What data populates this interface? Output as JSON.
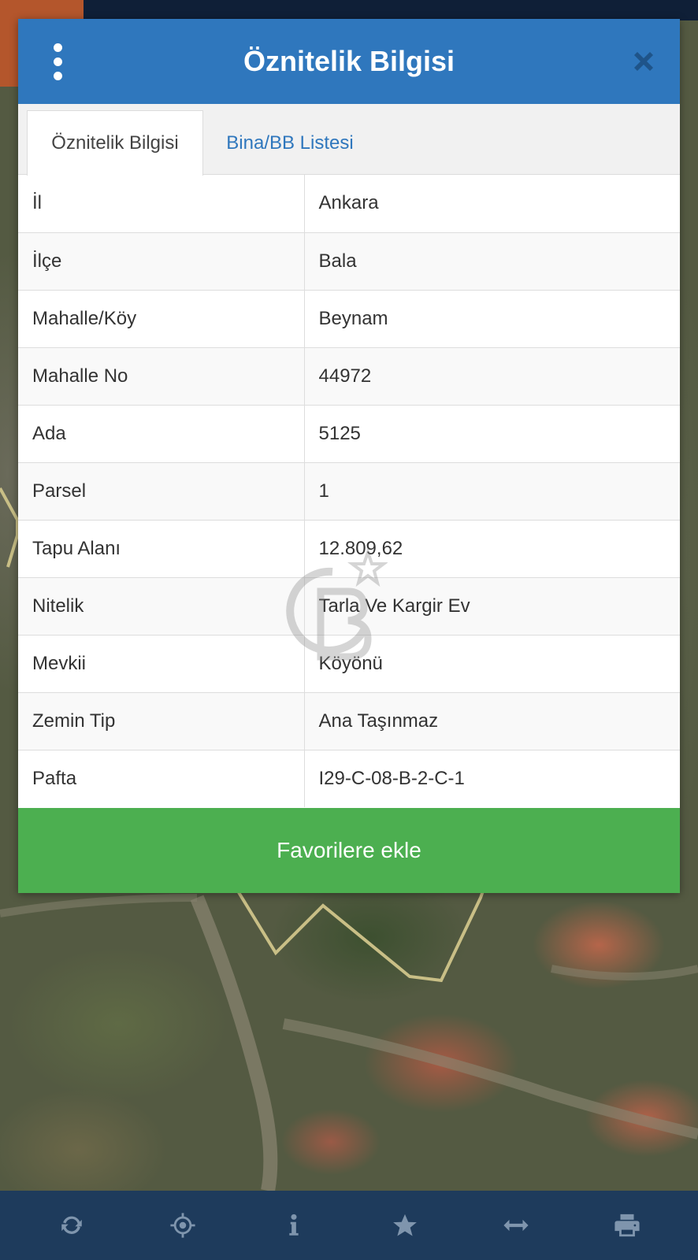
{
  "dialog": {
    "title": "Öznitelik Bilgisi",
    "tabs": [
      {
        "label": "Öznitelik Bilgisi",
        "active": true
      },
      {
        "label": "Bina/BB Listesi",
        "active": false
      }
    ],
    "rows": [
      {
        "key": "İl",
        "value": "Ankara"
      },
      {
        "key": "İlçe",
        "value": "Bala"
      },
      {
        "key": "Mahalle/Köy",
        "value": "Beynam"
      },
      {
        "key": "Mahalle No",
        "value": "44972"
      },
      {
        "key": "Ada",
        "value": "5125"
      },
      {
        "key": "Parsel",
        "value": "1"
      },
      {
        "key": "Tapu Alanı",
        "value": "12.809,62"
      },
      {
        "key": "Nitelik",
        "value": "Tarla Ve Kargir Ev"
      },
      {
        "key": "Mevkii",
        "value": "Köyönü"
      },
      {
        "key": "Zemin Tip",
        "value": "Ana Taşınmaz"
      },
      {
        "key": "Pafta",
        "value": "I29-C-08-B-2-C-1"
      }
    ],
    "favorite_label": "Favorilere ekle"
  },
  "toolbar": {
    "icons": [
      "refresh-icon",
      "locate-icon",
      "info-icon",
      "star-icon",
      "measure-icon",
      "print-icon"
    ]
  },
  "colors": {
    "header": "#2f77bd",
    "favorite": "#4caf50",
    "toolbar": "#1e3b5c",
    "toolbar_icon": "#7f95ad"
  }
}
